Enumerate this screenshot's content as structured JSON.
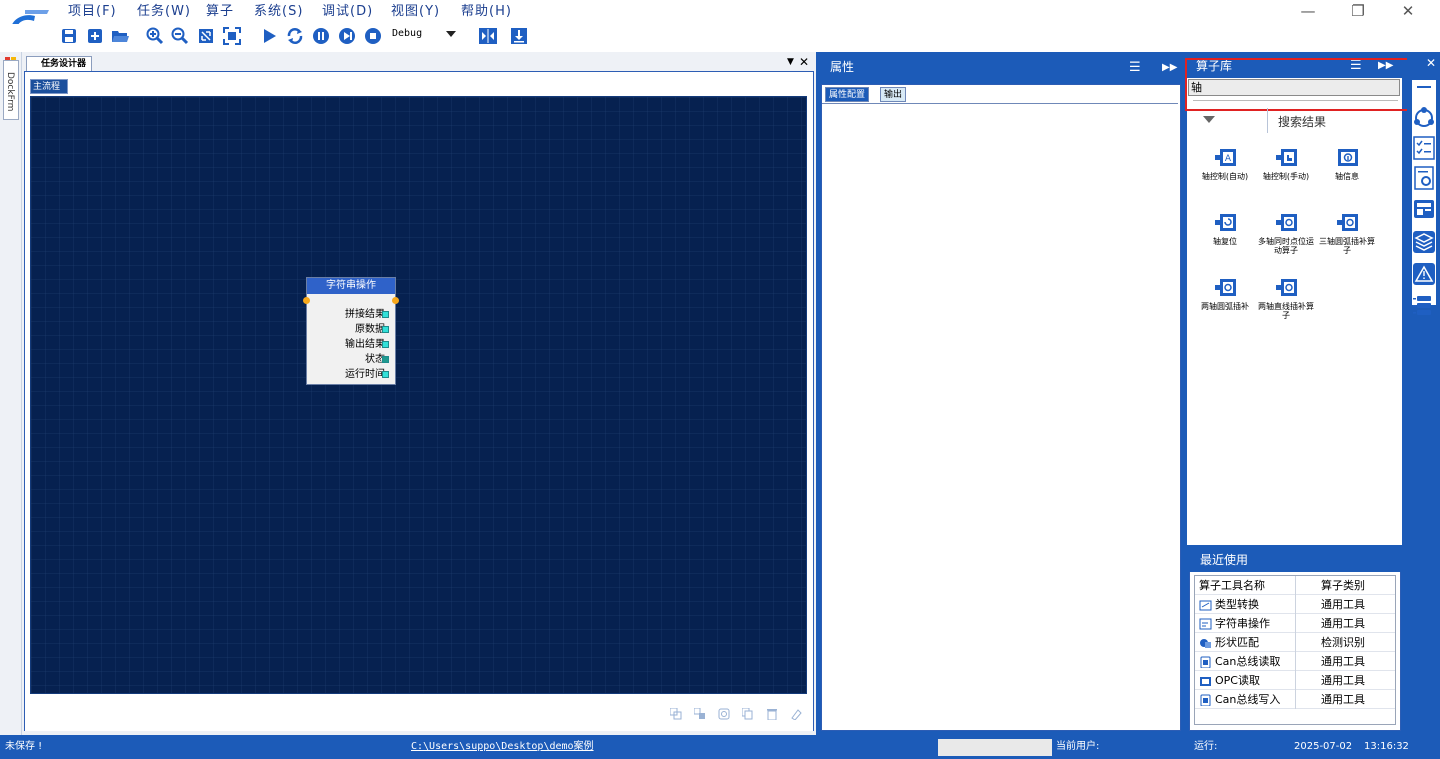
{
  "menu": [
    "项目(F)",
    "任务(W)",
    "算子",
    "系统(S)",
    "调试(D)",
    "视图(Y)",
    "帮助(H)"
  ],
  "toolbar": {
    "build_mode": "Debug"
  },
  "dock": {
    "side_label": "DockFrm"
  },
  "designer": {
    "tab": "任务设计器",
    "flow_tab": "主流程",
    "node": {
      "title": "字符串操作",
      "ports": [
        "拼接结果",
        "原数据",
        "输出结果",
        "状态",
        "运行时间"
      ]
    }
  },
  "properties": {
    "title": "属性",
    "tabs": [
      "属性配置",
      "输出"
    ]
  },
  "library": {
    "title": "算子库",
    "search_value": "轴",
    "results_label": "搜索结果",
    "operators": [
      {
        "name": "轴控制(自动)"
      },
      {
        "name": "轴控制(手动)"
      },
      {
        "name": "轴信息"
      },
      {
        "name": "轴复位"
      },
      {
        "name": "多轴同时点位运动算子"
      },
      {
        "name": "三轴圆弧插补算子"
      },
      {
        "name": "两轴圆弧插补"
      },
      {
        "name": "两轴直线插补算子"
      }
    ]
  },
  "recent": {
    "title": "最近使用",
    "columns": [
      "算子工具名称",
      "算子类别"
    ],
    "rows": [
      {
        "name": "类型转换",
        "category": "通用工具"
      },
      {
        "name": "字符串操作",
        "category": "通用工具"
      },
      {
        "name": "形状匹配",
        "category": "检测识别"
      },
      {
        "name": "Can总线读取",
        "category": "通用工具"
      },
      {
        "name": "OPC读取",
        "category": "通用工具"
      },
      {
        "name": "Can总线写入",
        "category": "通用工具"
      }
    ]
  },
  "status": {
    "save_state": "未保存 !",
    "path": "C:\\Users\\suppo\\Desktop\\demo案例",
    "current_user_label": "当前用户:",
    "run_label": "运行:",
    "date": "2025-07-02",
    "time": "13:16:32"
  },
  "colors": {
    "accent": "#1c5bb8",
    "canvas": "#062150",
    "node_title": "#2f62c9",
    "highlight": "#e02222"
  }
}
